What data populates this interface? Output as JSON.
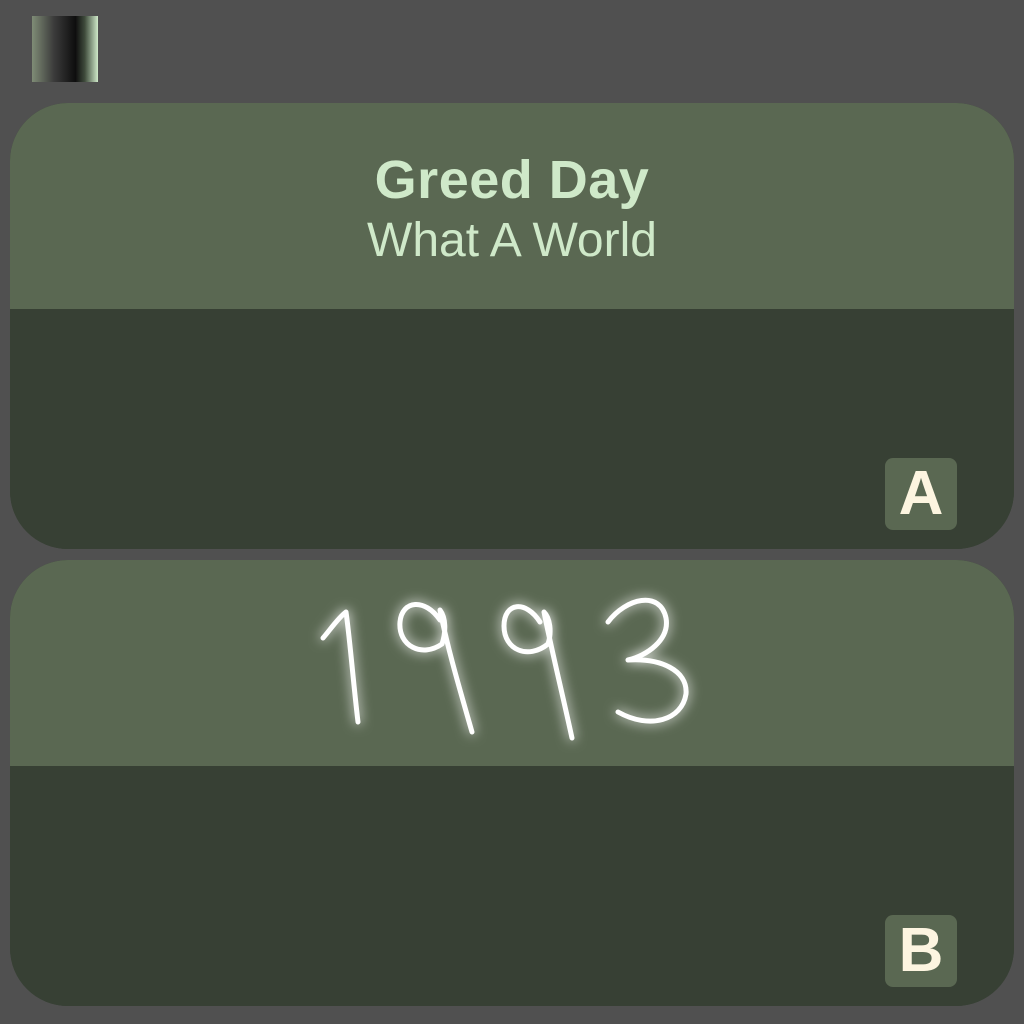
{
  "controls": {
    "pause_icon": "pause-icon"
  },
  "cards": [
    {
      "kind": "song",
      "title": "Greed Day",
      "subtitle": "What A World",
      "choice_label": "A"
    },
    {
      "kind": "year",
      "year": "1993",
      "choice_label": "B"
    }
  ],
  "colors": {
    "background": "#505050",
    "card_header": "#5a6852",
    "card_body": "#374034",
    "title_text": "#cfe9c9",
    "badge_text": "#fdf5e0"
  }
}
